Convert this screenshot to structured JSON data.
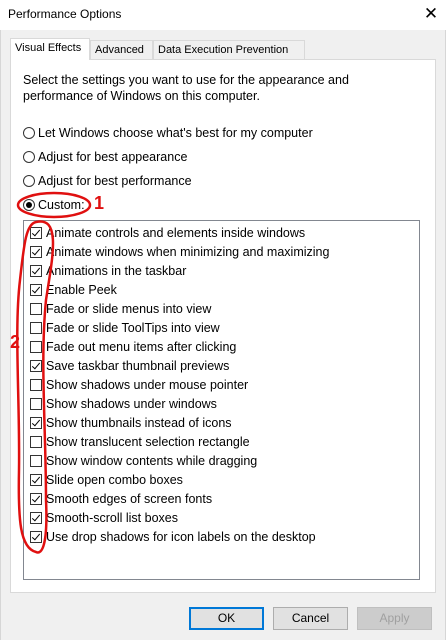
{
  "window": {
    "title": "Performance Options",
    "close_glyph": "✕"
  },
  "tabs": [
    {
      "label": "Visual Effects",
      "active": true
    },
    {
      "label": "Advanced",
      "active": false
    },
    {
      "label": "Data Execution Prevention",
      "active": false
    }
  ],
  "description": "Select the settings you want to use for the appearance and performance of Windows on this computer.",
  "radios": [
    {
      "label": "Let Windows choose what's best for my computer",
      "checked": false
    },
    {
      "label": "Adjust for best appearance",
      "checked": false
    },
    {
      "label": "Adjust for best performance",
      "checked": false
    },
    {
      "label": "Custom:",
      "checked": true
    }
  ],
  "effects": [
    {
      "label": "Animate controls and elements inside windows",
      "checked": true
    },
    {
      "label": "Animate windows when minimizing and maximizing",
      "checked": true
    },
    {
      "label": "Animations in the taskbar",
      "checked": true
    },
    {
      "label": "Enable Peek",
      "checked": true
    },
    {
      "label": "Fade or slide menus into view",
      "checked": false
    },
    {
      "label": "Fade or slide ToolTips into view",
      "checked": false
    },
    {
      "label": "Fade out menu items after clicking",
      "checked": false
    },
    {
      "label": "Save taskbar thumbnail previews",
      "checked": true
    },
    {
      "label": "Show shadows under mouse pointer",
      "checked": false
    },
    {
      "label": "Show shadows under windows",
      "checked": false
    },
    {
      "label": "Show thumbnails instead of icons",
      "checked": true
    },
    {
      "label": "Show translucent selection rectangle",
      "checked": false
    },
    {
      "label": "Show window contents while dragging",
      "checked": false
    },
    {
      "label": "Slide open combo boxes",
      "checked": true
    },
    {
      "label": "Smooth edges of screen fonts",
      "checked": true
    },
    {
      "label": "Smooth-scroll list boxes",
      "checked": true
    },
    {
      "label": "Use drop shadows for icon labels on the desktop",
      "checked": true
    }
  ],
  "buttons": {
    "ok": "OK",
    "cancel": "Cancel",
    "apply": "Apply"
  },
  "annotations": {
    "marker1": "1",
    "marker2": "2",
    "color": "#e01010"
  },
  "colors": {
    "accent": "#0078d7",
    "dialog_bg": "#f0f0f0"
  }
}
